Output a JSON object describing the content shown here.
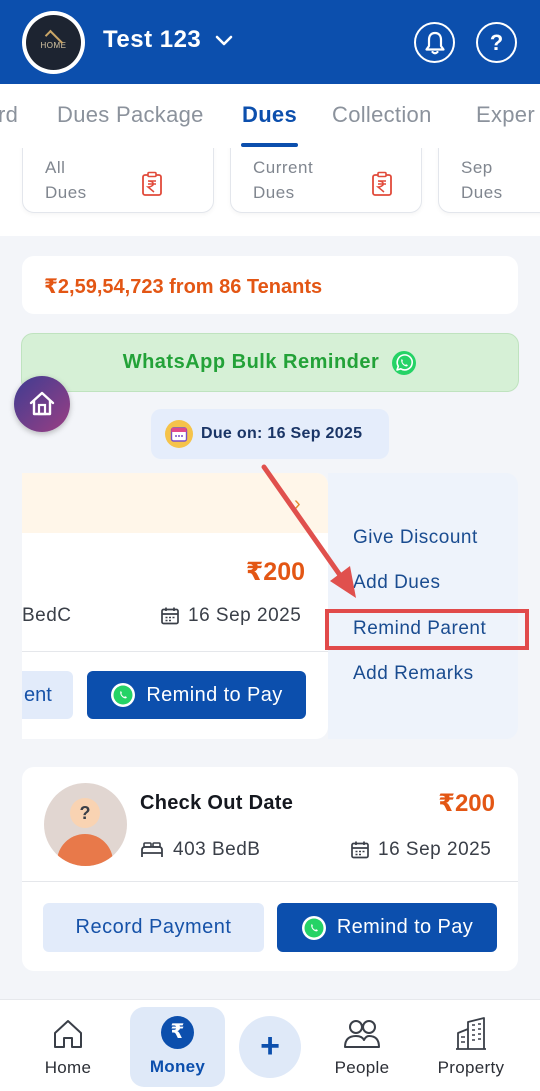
{
  "header": {
    "logo_text": "HOME",
    "title": "Test 123"
  },
  "tabs": [
    {
      "label": "rd"
    },
    {
      "label": "Dues Package"
    },
    {
      "label": "Dues"
    },
    {
      "label": "Collection"
    },
    {
      "label": "Exper"
    }
  ],
  "summary_cards": [
    {
      "label_line1": "All",
      "label_line2": "Dues"
    },
    {
      "label_line1": "Current",
      "label_line2": "Dues"
    },
    {
      "label_line1": "Sep",
      "label_line2": "Dues"
    }
  ],
  "total_text": "₹2,59,54,723 from 86 Tenants",
  "bulk_reminder_label": "WhatsApp Bulk Reminder",
  "due_chip_label": "Due on: 16 Sep 2025",
  "swiped_card": {
    "amount": "₹200",
    "bed": "BedC",
    "date": "16 Sep 2025",
    "record_btn_partial": "ent",
    "remind_btn": "Remind to Pay"
  },
  "actions": [
    {
      "label": "Give Discount"
    },
    {
      "label": "Add Dues"
    },
    {
      "label": "Remind Parent"
    },
    {
      "label": "Add Remarks"
    }
  ],
  "tenant_card": {
    "name": "Check Out Date",
    "amount": "₹200",
    "bed": "403 BedB",
    "date": "16 Sep 2025",
    "record_btn": "Record Payment",
    "remind_btn": "Remind to Pay"
  },
  "bottom_nav": {
    "home": "Home",
    "money": "Money",
    "people": "People",
    "property": "Property"
  },
  "colors": {
    "primary": "#0c4fad",
    "accent_orange": "#e35614",
    "whatsapp_green": "#25d366",
    "highlight_red": "#e14a4a"
  }
}
